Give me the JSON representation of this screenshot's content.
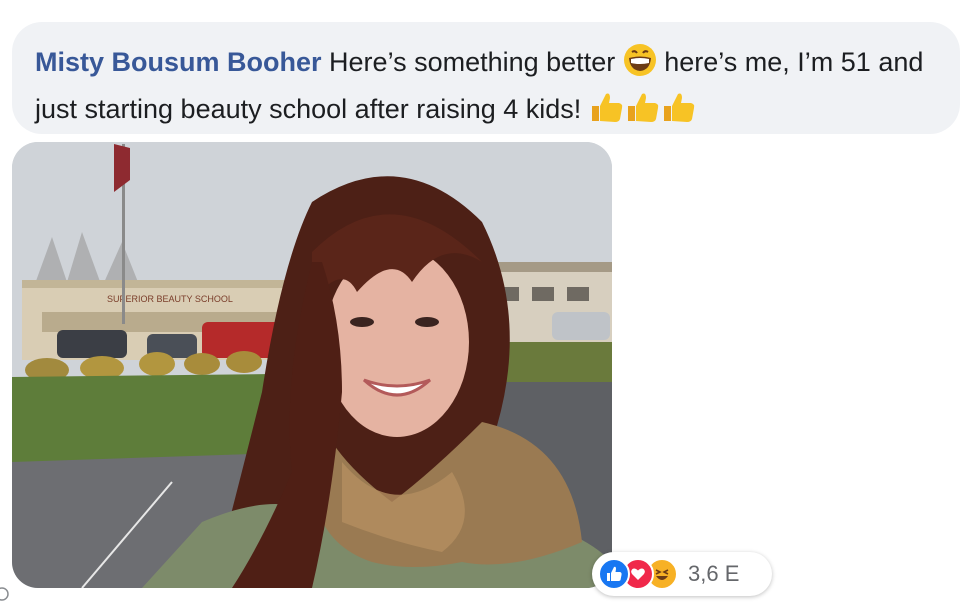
{
  "comment": {
    "author": "Misty Bousum Booher",
    "text_part1": "Here’s something better",
    "text_part2": "here’s me, I’m 51 and just starting beauty school after raising 4 kids!",
    "emoji_grin": "grinning-face-emoji",
    "emoji_thumbs": "thumbs-up-emoji"
  },
  "photo": {
    "building_sign": "SUPERIOR BEAUTY SCHOOL",
    "description_icon": "photo-selfie"
  },
  "reactions": {
    "count": "3,6 E",
    "types": [
      "like",
      "love",
      "haha"
    ]
  },
  "colors": {
    "author": "#385898",
    "bubble_bg": "#f0f2f5",
    "like": "#1877f2",
    "love": "#f0284a",
    "haha": "#f7b125"
  }
}
